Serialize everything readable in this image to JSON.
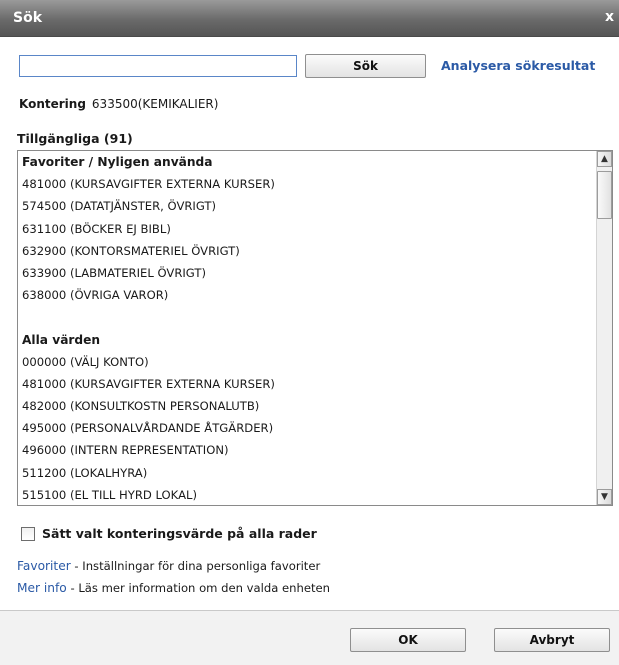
{
  "window": {
    "title": "Sök",
    "close_glyph": "x"
  },
  "search": {
    "value": "",
    "placeholder": "",
    "button_label": "Sök",
    "analyze_link": "Analysera sökresultat"
  },
  "kontering": {
    "label": "Kontering",
    "value": "633500(KEMIKALIER)"
  },
  "available": {
    "heading": "Tillgängliga (91)",
    "rows": [
      {
        "text": "Favoriter / Nyligen använda",
        "type": "group"
      },
      {
        "text": "481000 (KURSAVGIFTER EXTERNA KURSER)",
        "type": "item"
      },
      {
        "text": "574500 (DATATJÄNSTER, ÖVRIGT)",
        "type": "item"
      },
      {
        "text": "631100 (BÖCKER EJ BIBL)",
        "type": "item"
      },
      {
        "text": "632900 (KONTORSMATERIEL ÖVRIGT)",
        "type": "item"
      },
      {
        "text": "633900 (LABMATERIEL ÖVRIGT)",
        "type": "item"
      },
      {
        "text": "638000 (ÖVRIGA VAROR)",
        "type": "item"
      },
      {
        "text": "",
        "type": "blank"
      },
      {
        "text": "Alla värden",
        "type": "group"
      },
      {
        "text": "000000 (VÄLJ KONTO)",
        "type": "item"
      },
      {
        "text": "481000 (KURSAVGIFTER EXTERNA KURSER)",
        "type": "item"
      },
      {
        "text": "482000 (KONSULTKOSTN PERSONALUTB)",
        "type": "item"
      },
      {
        "text": "495000 (PERSONALVÅRDANDE ÅTGÄRDER)",
        "type": "item"
      },
      {
        "text": "496000 (INTERN REPRESENTATION)",
        "type": "item"
      },
      {
        "text": "511200 (LOKALHYRA)",
        "type": "item"
      },
      {
        "text": "515100 (EL TILL HYRD LOKAL)",
        "type": "item"
      }
    ]
  },
  "apply_all": {
    "label": "Sätt valt konteringsvärde på alla rader",
    "checked": false
  },
  "info": {
    "favorites_link": "Favoriter",
    "favorites_text": " - Inställningar för dina personliga favoriter",
    "more_link": "Mer info",
    "more_text": " - Läs mer information om den valda enheten"
  },
  "footer": {
    "ok_label": "OK",
    "cancel_label": "Avbryt"
  },
  "icons": {
    "scroll_up": "▲",
    "scroll_down": "▼"
  },
  "colors": {
    "link": "#2b5aa6",
    "titlebar": "#6a6a6a"
  }
}
